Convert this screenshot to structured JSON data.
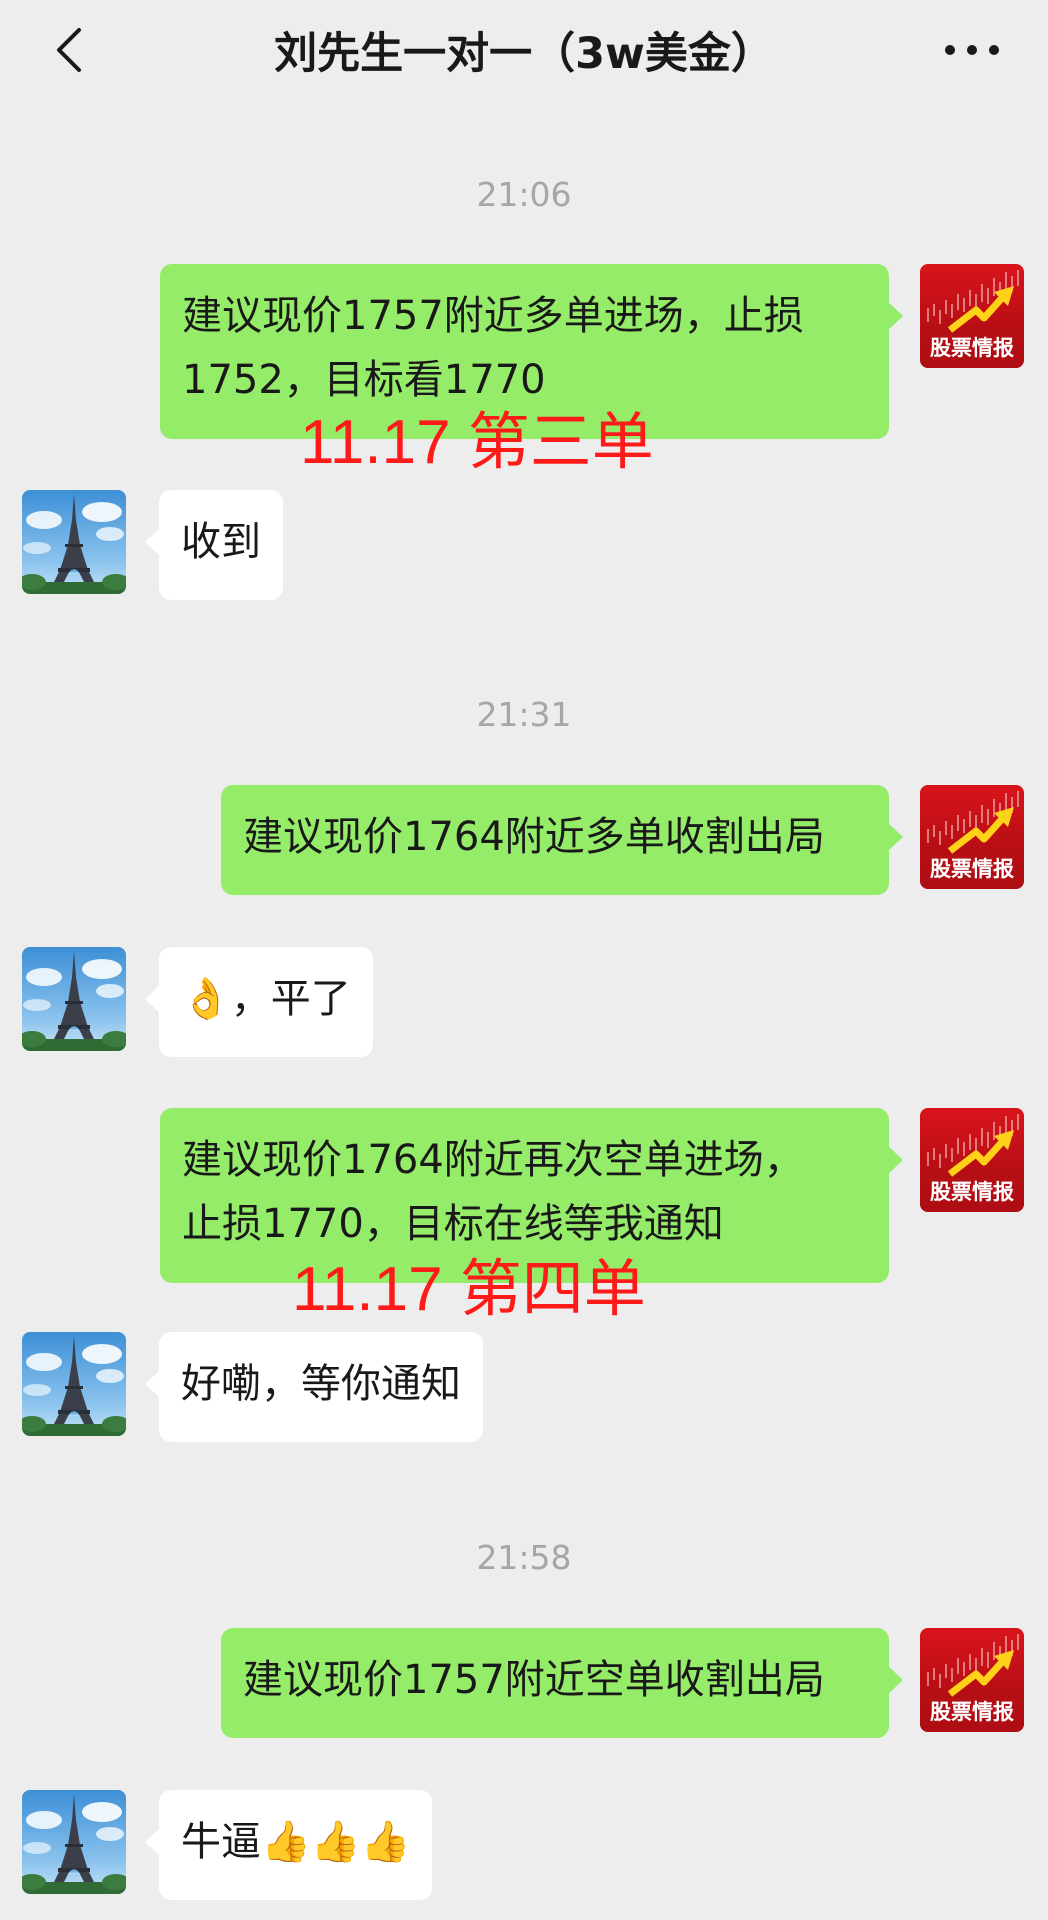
{
  "header": {
    "title": "刘先生一对一（3w美金）"
  },
  "messages": [
    {
      "type": "timestamp",
      "text": "21:06"
    },
    {
      "type": "sent",
      "lines": [
        "建议现价1757附近多单进场，止损",
        "1752，目标看1770"
      ],
      "avatar_text": "股票情报"
    },
    {
      "type": "annotation",
      "text": "11.17  第三单"
    },
    {
      "type": "received",
      "text": "收到"
    },
    {
      "type": "timestamp",
      "text": "21:31"
    },
    {
      "type": "sent",
      "lines": [
        "建议现价1764附近多单收割出局"
      ],
      "avatar_text": "股票情报"
    },
    {
      "type": "received",
      "emoji": "👌",
      "text": "，平了"
    },
    {
      "type": "sent",
      "lines": [
        "建议现价1764附近再次空单进场，",
        "止损1770，目标在线等我通知"
      ],
      "avatar_text": "股票情报"
    },
    {
      "type": "annotation",
      "text": "11.17  第四单"
    },
    {
      "type": "received",
      "text": "好嘞，等你通知"
    },
    {
      "type": "timestamp",
      "text": "21:58"
    },
    {
      "type": "sent",
      "lines": [
        "建议现价1757附近空单收割出局"
      ],
      "avatar_text": "股票情报"
    },
    {
      "type": "received",
      "text": "牛逼",
      "emoji": "👍👍👍"
    }
  ],
  "colors": {
    "background": "#ededed",
    "sent_bubble": "#95ec69",
    "received_bubble": "#ffffff",
    "annotation": "#ff1a1a",
    "timestamp": "#a6a6a6"
  },
  "icons": {
    "back": "chevron-left-icon",
    "more": "more-dots-icon",
    "contact_avatar": "eiffel-tower-avatar",
    "self_avatar": "stock-chart-avatar"
  }
}
